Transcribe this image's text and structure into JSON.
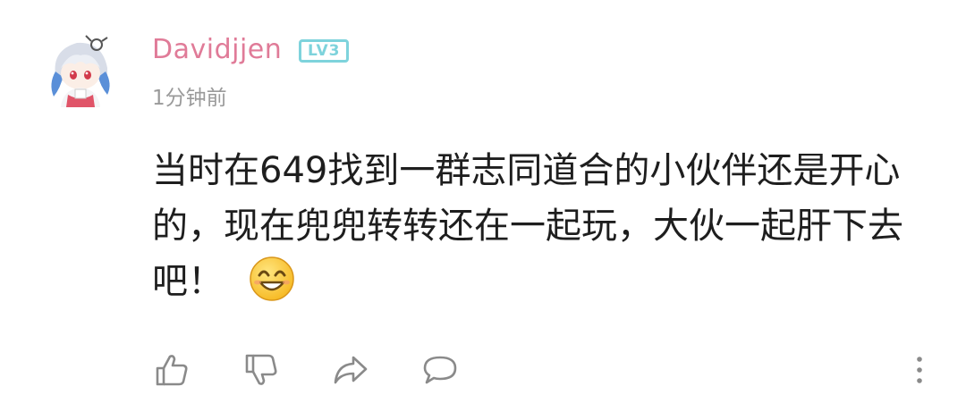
{
  "comment": {
    "username": "Davidjjen",
    "level": "LV3",
    "timestamp": "1分钟前",
    "text": "当时在649找到一群志同道合的小伙伴还是开心的，现在兜兜转转还在一起玩，大伙一起肝下去吧！",
    "emoji": "grinning-face-emoji"
  },
  "actions": {
    "like_icon": "thumbs-up-icon",
    "dislike_icon": "thumbs-down-icon",
    "share_icon": "share-arrow-icon",
    "reply_icon": "speech-bubble-icon",
    "more_icon": "more-vertical-icon"
  },
  "colors": {
    "username": "#e07b98",
    "level_badge": "#7ed3dc",
    "timestamp": "#9a9a9a",
    "text": "#1e1e1e",
    "icon": "#8a8a8a"
  }
}
